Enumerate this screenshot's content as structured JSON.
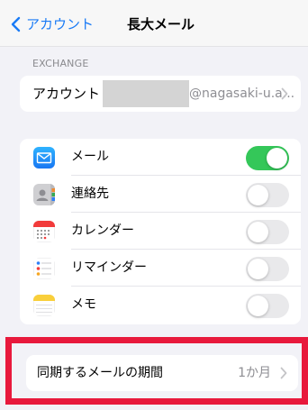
{
  "navbar": {
    "back_label": "アカウント",
    "title": "長大メール"
  },
  "account_section": {
    "header": "EXCHANGE",
    "label": "アカウント",
    "value": "@nagasaki-u.a..."
  },
  "sync_items": [
    {
      "label": "メール",
      "icon": "mail-icon",
      "enabled": true
    },
    {
      "label": "連絡先",
      "icon": "contacts-icon",
      "enabled": false
    },
    {
      "label": "カレンダー",
      "icon": "calendar-icon",
      "enabled": false
    },
    {
      "label": "リマインダー",
      "icon": "reminders-icon",
      "enabled": false
    },
    {
      "label": "メモ",
      "icon": "notes-icon",
      "enabled": false
    }
  ],
  "mail_sync_period": {
    "label": "同期するメールの期間",
    "value": "1か月"
  },
  "colors": {
    "accent": "#1a7bf6",
    "toggle_on": "#34c759",
    "highlight_border": "#e8193c"
  }
}
